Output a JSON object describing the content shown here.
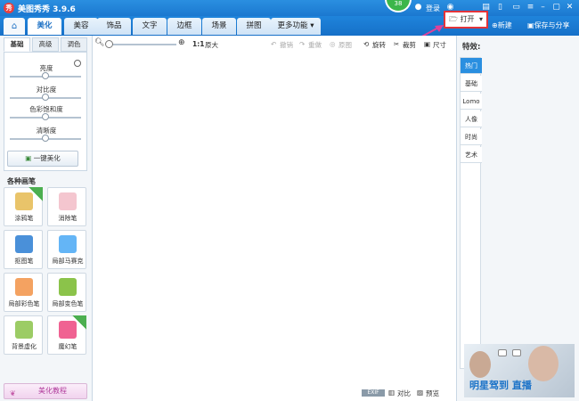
{
  "app": {
    "title": "美图秀秀 3.9.6",
    "badge": "38"
  },
  "titlebar": {
    "login": "登录"
  },
  "tabs": [
    {
      "label": "美化",
      "active": true
    },
    {
      "label": "美容"
    },
    {
      "label": "饰品"
    },
    {
      "label": "文字"
    },
    {
      "label": "边框"
    },
    {
      "label": "场景"
    },
    {
      "label": "拼图"
    },
    {
      "label": "更多功能 ▾"
    }
  ],
  "header_actions": {
    "open": "打开",
    "new": "新建",
    "save": "保存与分享"
  },
  "left": {
    "subtabs": [
      "基础",
      "高级",
      "调色"
    ],
    "sliders": [
      {
        "label": "亮度",
        "value": 0.5
      },
      {
        "label": "对比度",
        "value": 0.5
      },
      {
        "label": "色彩饱和度",
        "value": 0.5
      },
      {
        "label": "清晰度",
        "value": 0.5
      }
    ],
    "one_key": "一键美化",
    "brushes_title": "各种画笔",
    "brushes": [
      {
        "label": "涂鸦笔",
        "color": "#e9c46a"
      },
      {
        "label": "消除笔",
        "color": "#f4c6cf"
      },
      {
        "label": "抠图笔",
        "color": "#4a90d9"
      },
      {
        "label": "局部马赛克",
        "color": "#64b5f6"
      },
      {
        "label": "局部彩色笔",
        "color": "#f4a261"
      },
      {
        "label": "局部变色笔",
        "color": "#8bc34a"
      },
      {
        "label": "背景虚化",
        "color": "#9ccc65"
      },
      {
        "label": "魔幻笔",
        "color": "#f06292"
      }
    ],
    "tutorial": "美化教程"
  },
  "toolbar": {
    "ratio": "1:1",
    "original": "原大",
    "undo": "撤销",
    "redo": "重做",
    "reset": "原图",
    "rotate": "旋转",
    "crop": "裁剪",
    "size": "尺寸"
  },
  "status": {
    "exif": "EXIF",
    "compare": "对比",
    "preview": "预览"
  },
  "right": {
    "title": "特效:",
    "categories": [
      "热门",
      "基础",
      "Lomo",
      "人像",
      "时尚",
      "艺术"
    ],
    "ad_text": "明星驾到 直播"
  }
}
